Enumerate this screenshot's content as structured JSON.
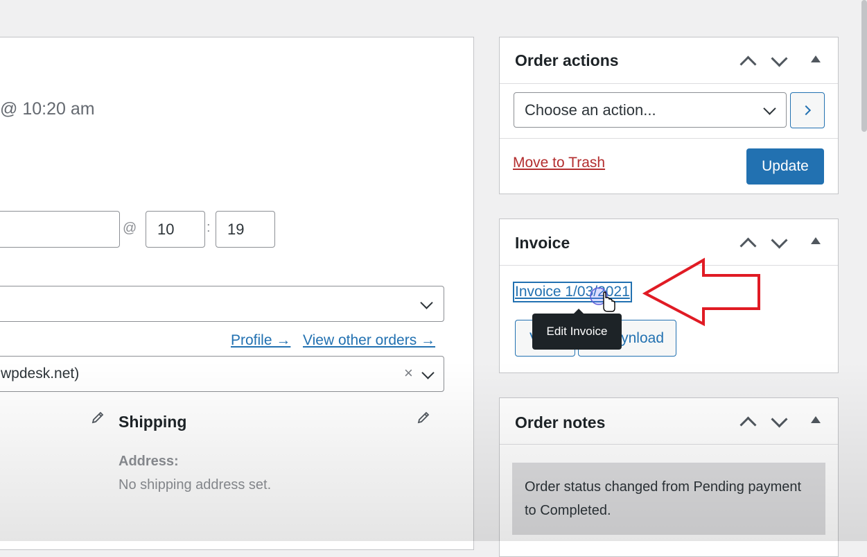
{
  "order": {
    "date_fragment": "@ 10:20 am",
    "hour": "10",
    "minute": "19",
    "at": "@",
    "colon": ":",
    "profile_link": "Profile →",
    "view_orders_link": "View other orders →",
    "customer_fragment": "wpdesk.net)",
    "clear_symbol": "×"
  },
  "shipping": {
    "heading": "Shipping",
    "address_label": "Address:",
    "address_value": "No shipping address set."
  },
  "order_actions": {
    "title": "Order actions",
    "select_value": "Choose an action...",
    "trash_link": "Move to Trash",
    "update_button": "Update"
  },
  "invoice": {
    "title": "Invoice",
    "invoice_link": "Invoice 1/03/2021",
    "view_button_fragment": "V",
    "download_button_fragment": "ynload",
    "tooltip": "Edit Invoice"
  },
  "order_notes": {
    "title": "Order notes",
    "note_text": "Order status changed from Pending payment to Completed."
  },
  "colors": {
    "accent": "#2271b1",
    "trash": "#b32d2e",
    "annotation_arrow": "#e01b24"
  },
  "icons": [
    "pencil-icon",
    "chevron-down-icon",
    "chevron-up-icon",
    "arrow-right-icon",
    "triangle-up-icon",
    "close-icon",
    "cursor-hand-icon",
    "annotation-arrow-icon"
  ]
}
